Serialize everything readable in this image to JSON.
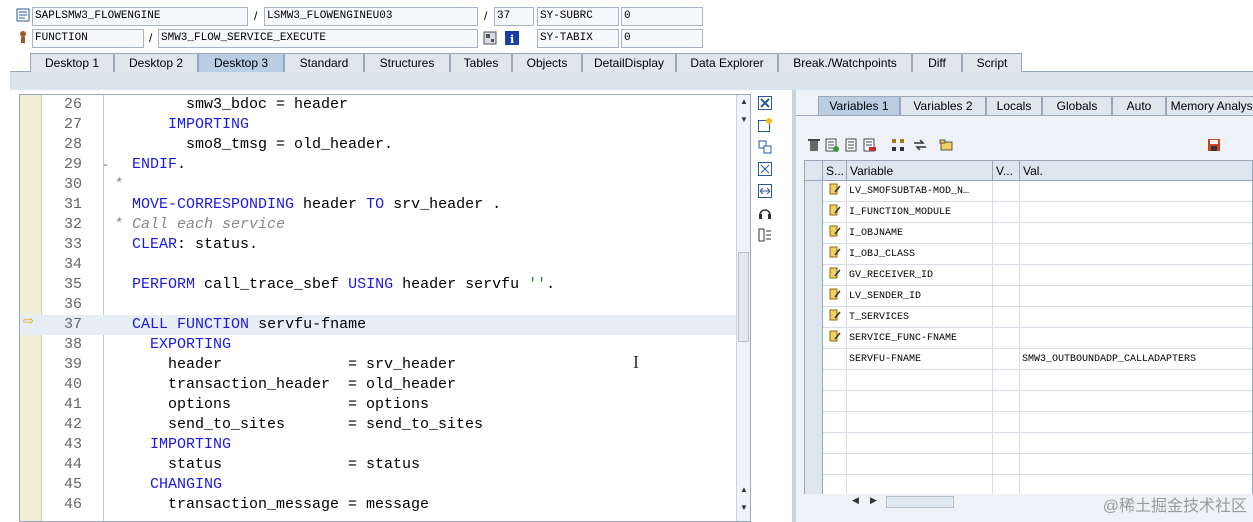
{
  "header": {
    "program": "SAPLSMW3_FLOWENGINE",
    "include": "LSMW3_FLOWENGINEU03",
    "line": "37",
    "sy_subrc_label": "SY-SUBRC",
    "sy_subrc_value": "0",
    "event_type": "FUNCTION",
    "event_name": "SMW3_FLOW_SERVICE_EXECUTE",
    "sy_tabix_label": "SY-TABIX",
    "sy_tabix_value": "0",
    "slash1": "/",
    "slash2": "/",
    "slash3": "/"
  },
  "tabs": [
    {
      "label": "Desktop 1"
    },
    {
      "label": "Desktop 2"
    },
    {
      "label": "Desktop 3"
    },
    {
      "label": "Standard"
    },
    {
      "label": "Structures"
    },
    {
      "label": "Tables"
    },
    {
      "label": "Objects"
    },
    {
      "label": "DetailDisplay"
    },
    {
      "label": "Data Explorer"
    },
    {
      "label": "Break./Watchpoints"
    },
    {
      "label": "Diff"
    },
    {
      "label": "Script"
    }
  ],
  "editor": {
    "lines": [
      {
        "num": "26",
        "code": "        smw3_bdoc = header"
      },
      {
        "num": "27",
        "code": "      IMPORTING"
      },
      {
        "num": "28",
        "code": "        smo8_tmsg = old_header."
      },
      {
        "num": "29",
        "code": "  ENDIF."
      },
      {
        "num": "30",
        "code": "*"
      },
      {
        "num": "31",
        "code": "  MOVE-CORRESPONDING header TO srv_header ."
      },
      {
        "num": "32",
        "code": "* Call each service"
      },
      {
        "num": "33",
        "code": "  CLEAR: status."
      },
      {
        "num": "34",
        "code": ""
      },
      {
        "num": "35",
        "code": "  PERFORM call_trace_sbef USING header servfu ''."
      },
      {
        "num": "36",
        "code": ""
      },
      {
        "num": "37",
        "code": "  CALL FUNCTION servfu-fname"
      },
      {
        "num": "38",
        "code": "    EXPORTING"
      },
      {
        "num": "39",
        "code": "      header              = srv_header"
      },
      {
        "num": "40",
        "code": "      transaction_header  = old_header"
      },
      {
        "num": "41",
        "code": "      options             = options"
      },
      {
        "num": "42",
        "code": "      send_to_sites       = send_to_sites"
      },
      {
        "num": "43",
        "code": "    IMPORTING"
      },
      {
        "num": "44",
        "code": "      status              = status"
      },
      {
        "num": "45",
        "code": "    CHANGING"
      },
      {
        "num": "46",
        "code": "      transaction_message = message"
      }
    ]
  },
  "right_tabs": [
    {
      "label": "Variables 1"
    },
    {
      "label": "Variables 2"
    },
    {
      "label": "Locals"
    },
    {
      "label": "Globals"
    },
    {
      "label": "Auto"
    },
    {
      "label": "Memory Analysis"
    }
  ],
  "grid": {
    "col_s": "S...",
    "col_variable": "Variable",
    "col_v": "V...",
    "col_val": "Val.",
    "rows": [
      {
        "var": "LV_SMOFSUBTAB-MOD_N…",
        "val": "",
        "icon": "edit-icon"
      },
      {
        "var": "I_FUNCTION_MODULE",
        "val": "",
        "icon": "edit-icon"
      },
      {
        "var": "I_OBJNAME",
        "val": "",
        "icon": "edit-icon"
      },
      {
        "var": "I_OBJ_CLASS",
        "val": "",
        "icon": "edit-icon"
      },
      {
        "var": "GV_RECEIVER_ID",
        "val": "",
        "icon": "edit-icon"
      },
      {
        "var": "LV_SENDER_ID",
        "val": "",
        "icon": "edit-icon"
      },
      {
        "var": "T_SERVICES",
        "val": "",
        "icon": "edit-icon"
      },
      {
        "var": "SERVICE_FUNC-FNAME",
        "val": "",
        "icon": "edit-icon"
      },
      {
        "var": "SERVFU-FNAME",
        "val": "SMW3_OUTBOUNDADP_CALLADAPTERS",
        "icon": ""
      },
      {
        "var": "",
        "val": "",
        "icon": ""
      },
      {
        "var": "",
        "val": "",
        "icon": ""
      },
      {
        "var": "",
        "val": "",
        "icon": ""
      },
      {
        "var": "",
        "val": "",
        "icon": ""
      },
      {
        "var": "",
        "val": "",
        "icon": ""
      },
      {
        "var": "",
        "val": "",
        "icon": ""
      }
    ]
  },
  "watermark": "@稀土掘金技术社区",
  "colors": {
    "keyword": "#1a1ae0",
    "comment": "#888888",
    "string": "#2a8a2a",
    "active_tab": "#b9cde3"
  }
}
